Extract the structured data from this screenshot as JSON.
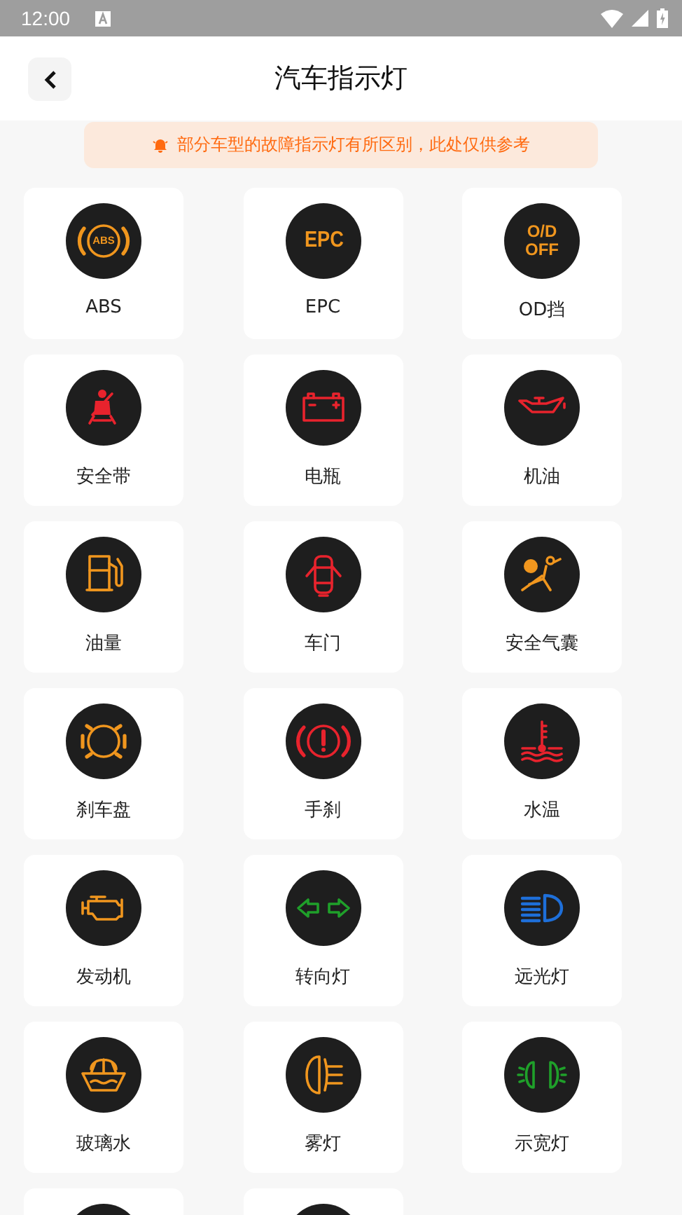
{
  "status_bar": {
    "time": "12:00"
  },
  "header": {
    "title": "汽车指示灯"
  },
  "notice": {
    "text": "部分车型的故障指示灯有所区别，此处仅供参考"
  },
  "indicators": [
    {
      "kind": "abs",
      "icon_text": "ABS",
      "color": "#f0961e",
      "label": "ABS"
    },
    {
      "kind": "epc",
      "icon_text": "EPC",
      "color": "#f0961e",
      "label": "EPC"
    },
    {
      "kind": "od",
      "icon_text": "O/D OFF",
      "color": "#f0961e",
      "label": "OD挡"
    },
    {
      "label": "安全带",
      "kind": "seatbelt",
      "color": "#e8232d"
    },
    {
      "label": "电瓶",
      "kind": "battery",
      "color": "#e8232d"
    },
    {
      "label": "机油",
      "kind": "oil",
      "color": "#e8232d"
    },
    {
      "label": "油量",
      "kind": "fuel",
      "color": "#f0961e"
    },
    {
      "label": "车门",
      "kind": "door",
      "color": "#e8232d"
    },
    {
      "label": "安全气囊",
      "kind": "airbag",
      "color": "#f0961e"
    },
    {
      "label": "刹车盘",
      "kind": "brakedisc",
      "color": "#f0961e"
    },
    {
      "label": "手刹",
      "kind": "handbrake",
      "color": "#e8232d"
    },
    {
      "label": "水温",
      "kind": "watertemp",
      "color": "#e8232d"
    },
    {
      "label": "发动机",
      "kind": "engine",
      "color": "#f0961e"
    },
    {
      "label": "转向灯",
      "kind": "turn",
      "color": "#1fa02a"
    },
    {
      "label": "远光灯",
      "kind": "highbeam",
      "color": "#1e6fd9"
    },
    {
      "label": "玻璃水",
      "kind": "washer",
      "color": "#f0961e"
    },
    {
      "label": "雾灯",
      "kind": "fog",
      "color": "#f0961e"
    },
    {
      "label": "示宽灯",
      "kind": "sidelight",
      "color": "#1fa02a"
    },
    {
      "kind": "cut"
    },
    {
      "kind": "cut"
    }
  ]
}
